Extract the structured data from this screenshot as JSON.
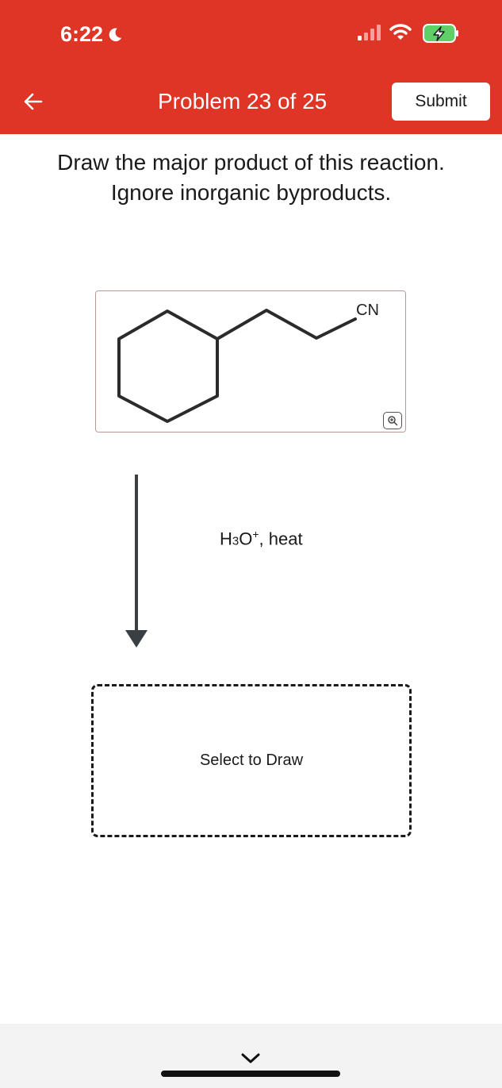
{
  "status_bar": {
    "time": "6:22",
    "icons": [
      "moon-icon",
      "signal-icon",
      "wifi-icon",
      "battery-charging-icon"
    ]
  },
  "header": {
    "title": "Problem 23 of 25",
    "submit_label": "Submit",
    "back_icon": "arrow-left-icon",
    "bg_color": "#de3527"
  },
  "question": {
    "line1": "Draw the major product of this reaction.",
    "line2": "Ignore inorganic byproducts."
  },
  "reactant": {
    "group_label": "CN",
    "zoom_icon": "zoom-in-icon"
  },
  "reaction": {
    "reagent_main": "H",
    "reagent_sub": "3",
    "reagent_o": "O",
    "reagent_sup": "+",
    "reagent_rest": ", heat"
  },
  "product": {
    "placeholder": "Select to Draw"
  }
}
